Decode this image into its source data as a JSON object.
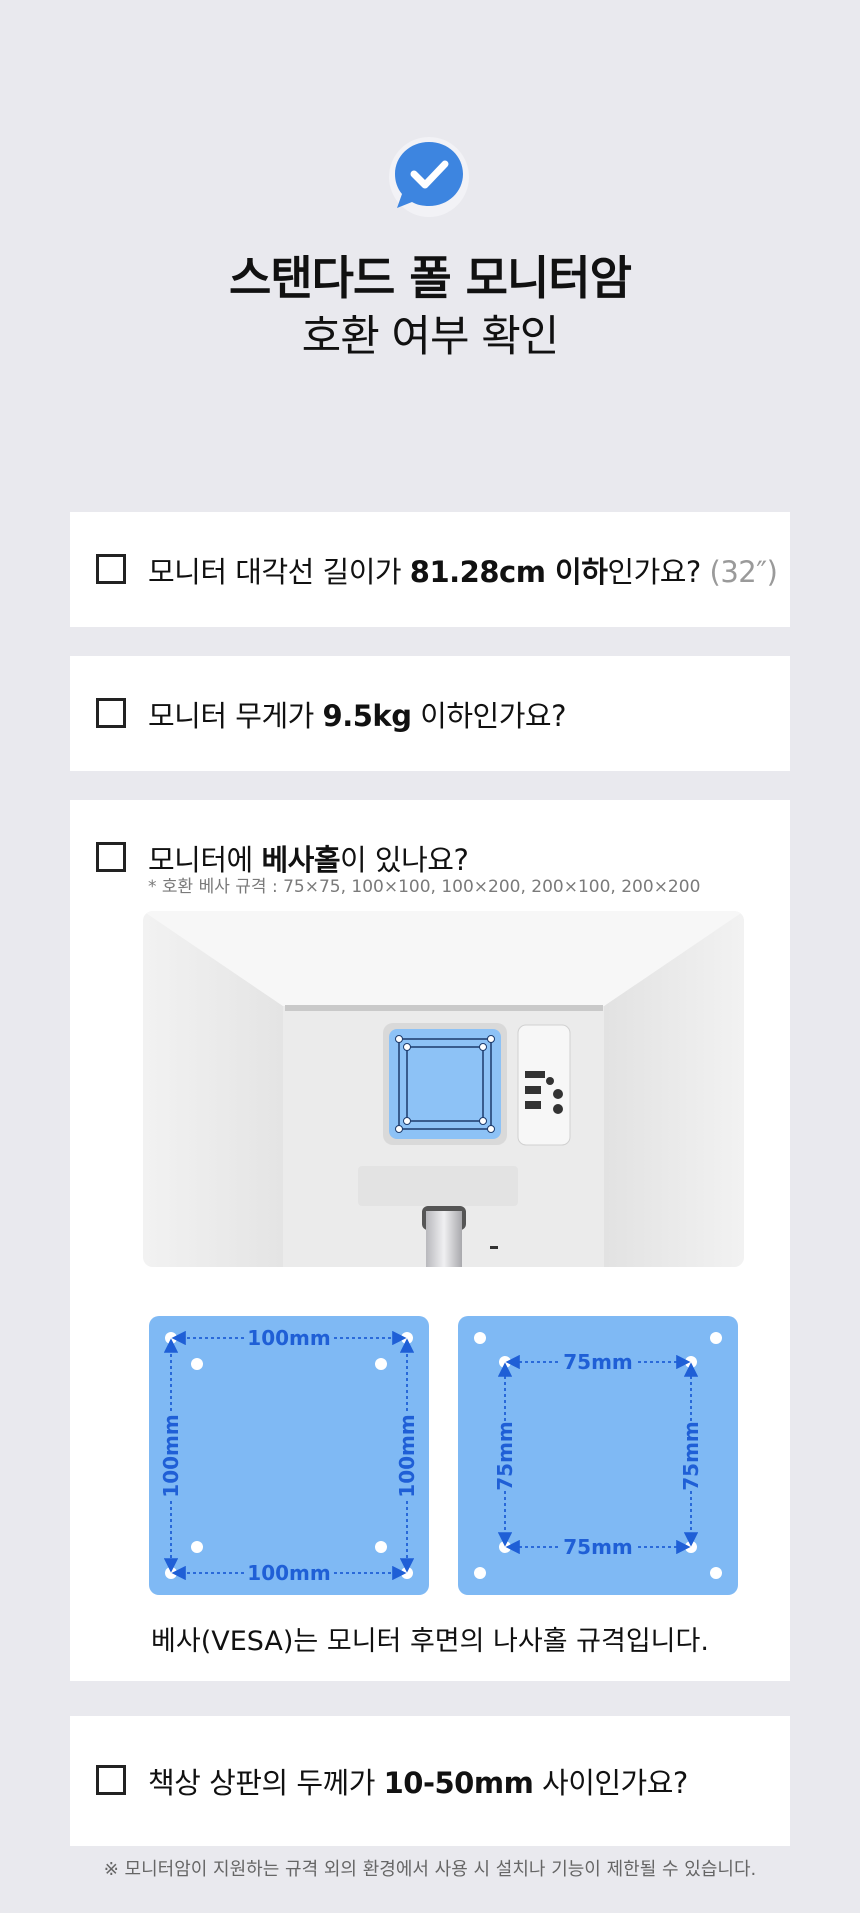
{
  "header": {
    "title_line1": "스탠다드 폴 모니터암",
    "title_line2": "호환 여부 확인",
    "badge_icon": "check-chat-bubble-icon",
    "accent_color": "#3d85e0"
  },
  "checklist": [
    {
      "prefix": "모니터 대각선 길이가 ",
      "bold": "81.28cm 이하",
      "suffix": "인가요? ",
      "muted": "(32″)",
      "checked": false
    },
    {
      "prefix": "모니터 무게가 ",
      "bold": "9.5kg",
      "suffix": " 이하인가요?",
      "checked": false
    },
    {
      "prefix": "모니터에 ",
      "bold": "베사홀",
      "suffix": "이 있나요?",
      "note": "*  호환 베사 규격 : 75×75, 100×100, 100×200, 200×100, 200×200",
      "checked": false
    },
    {
      "prefix": "책상 상판의 두께가 ",
      "bold": "10-50mm",
      "suffix": " 사이인가요?",
      "checked": false
    }
  ],
  "vesa": {
    "panel_color": "#7fb9f4",
    "large": {
      "top": "100mm",
      "bottom": "100mm",
      "left": "100mm",
      "right": "100mm"
    },
    "small": {
      "top": "75mm",
      "bottom": "75mm",
      "left": "75mm",
      "right": "75mm"
    },
    "caption": "베사(VESA)는 모니터 후면의 나사홀 규격입니다."
  },
  "footer_note": "※ 모니터암이 지원하는 규격 외의 환경에서 사용 시 설치나 기능이 제한될 수 있습니다."
}
